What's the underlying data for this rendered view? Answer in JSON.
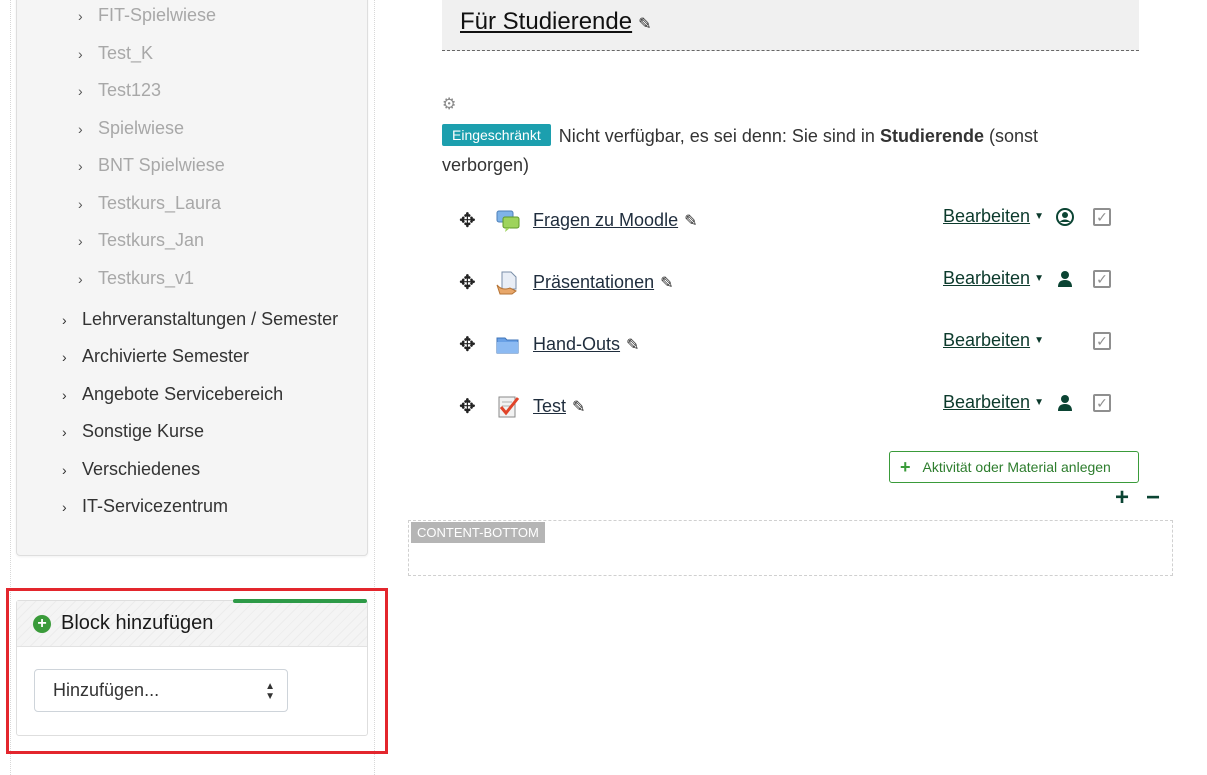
{
  "nav": {
    "sub_items": [
      {
        "label": "FIT-Spielwiese"
      },
      {
        "label": "Test_K"
      },
      {
        "label": "Test123"
      },
      {
        "label": "Spielwiese"
      },
      {
        "label": "BNT Spielwiese"
      },
      {
        "label": "Testkurs_Laura"
      },
      {
        "label": "Testkurs_Jan"
      },
      {
        "label": "Testkurs_v1"
      }
    ],
    "top_items": [
      {
        "label": "Lehrveranstaltungen / Semester"
      },
      {
        "label": "Archivierte Semester"
      },
      {
        "label": "Angebote Servicebereich"
      },
      {
        "label": "Sonstige Kurse"
      },
      {
        "label": "Verschiedenes"
      },
      {
        "label": "IT-Servicezentrum"
      }
    ],
    "chevron": "›"
  },
  "block": {
    "title": "Block hinzufügen",
    "select_value": "Hinzufügen..."
  },
  "section": {
    "title": "Für Studierende",
    "restriction_badge": "Eingeschränkt",
    "restriction_text": "Nicht verfügbar, es sei denn: Sie sind in",
    "restriction_group": "Studierende",
    "restriction_suffix": "(sonst verborgen)"
  },
  "activities": [
    {
      "name": "Fragen zu Moodle",
      "edit": "Bearbeiten",
      "icon": "forum-icon",
      "visibility_icon": "user-circle-icon"
    },
    {
      "name": "Präsentationen",
      "edit": "Bearbeiten",
      "icon": "file-icon",
      "visibility_icon": "user-icon"
    },
    {
      "name": "Hand-Outs",
      "edit": "Bearbeiten",
      "icon": "folder-icon",
      "visibility_icon": ""
    },
    {
      "name": "Test",
      "edit": "Bearbeiten",
      "icon": "quiz-icon",
      "visibility_icon": "user-icon"
    }
  ],
  "add_activity_label": "Aktivität oder Material anlegen",
  "content_bottom_label": "CONTENT-BOTTOM",
  "colors": {
    "badge": "#1c9fae",
    "accent_green": "#3a9b3a",
    "highlight_red": "#e3262d"
  }
}
